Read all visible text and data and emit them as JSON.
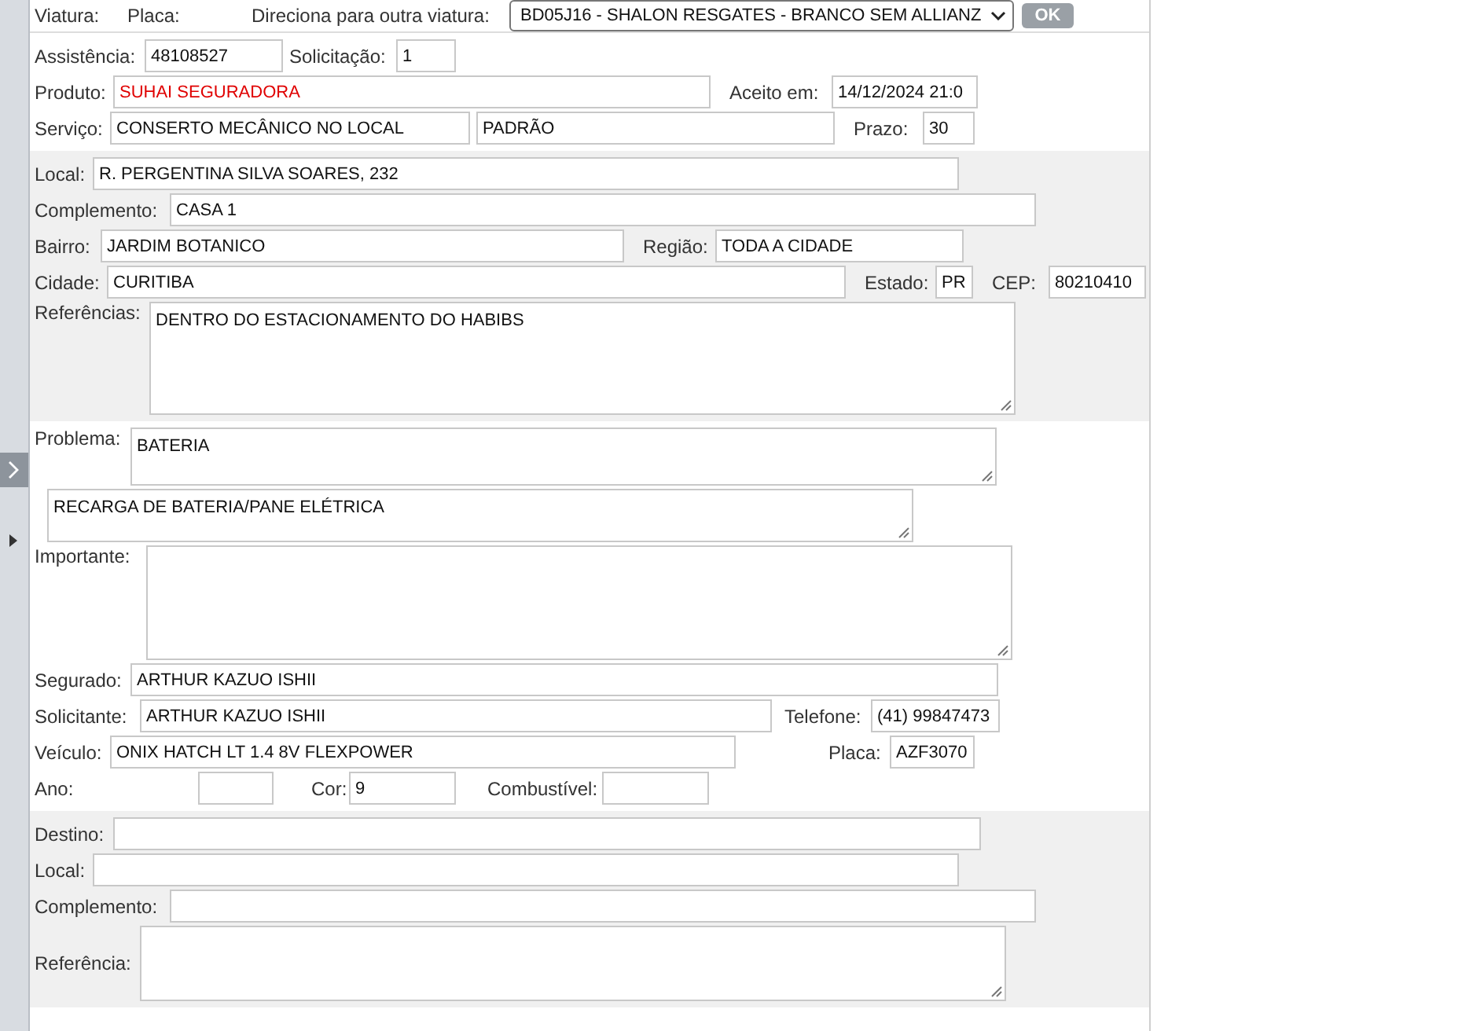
{
  "top_bar": {
    "viatura_label": "Viatura:",
    "placa_label": "Placa:",
    "redirect_label": "Direciona para outra viatura:",
    "vehicle_select": "BD05J16 - SHALON RESGATES - BRANCO SEM ALLIANZ",
    "ok_button": "OK"
  },
  "sections": [
    {
      "shaded": false,
      "rows": [
        {
          "fields": [
            {
              "label": "Assistência:",
              "value": "48108527",
              "kind": "input"
            },
            {
              "label": "Solicitação:",
              "value": "1",
              "kind": "input"
            }
          ]
        },
        {
          "fields": [
            {
              "label": "Produto:",
              "value": "SUHAI SEGURADORA",
              "kind": "input",
              "color": "#e00000"
            },
            {
              "label": "Aceito em:",
              "value": "14/12/2024 21:0",
              "kind": "input"
            }
          ]
        },
        {
          "fields": [
            {
              "label": "Serviço:",
              "value": "CONSERTO MECÂNICO NO LOCAL",
              "kind": "input"
            },
            {
              "value": "PADRÃO",
              "kind": "input"
            },
            {
              "label": "Prazo:",
              "value": "30",
              "kind": "input"
            }
          ]
        }
      ]
    },
    {
      "shaded": true,
      "rows": [
        {
          "fields": [
            {
              "label": "Local:",
              "value": "R. PERGENTINA SILVA SOARES, 232",
              "kind": "input"
            }
          ]
        },
        {
          "fields": [
            {
              "label": "Complemento:",
              "value": "CASA 1",
              "kind": "input"
            }
          ]
        },
        {
          "fields": [
            {
              "label": "Bairro:",
              "value": "JARDIM BOTANICO",
              "kind": "input"
            },
            {
              "label": "Região:",
              "value": "TODA A CIDADE",
              "kind": "input"
            }
          ]
        },
        {
          "fields": [
            {
              "label": "Cidade:",
              "value": "CURITIBA",
              "kind": "input"
            },
            {
              "label": "Estado:",
              "value": "PR",
              "kind": "input"
            },
            {
              "label": "CEP:",
              "value": "80210410",
              "kind": "input"
            }
          ]
        },
        {
          "fields": [
            {
              "label": "Referências:",
              "value": "DENTRO DO ESTACIONAMENTO DO HABIBS",
              "kind": "textarea"
            }
          ]
        }
      ]
    },
    {
      "shaded": false,
      "rows": [
        {
          "fields": [
            {
              "label": "Problema:",
              "value": "BATERIA",
              "kind": "textarea"
            }
          ]
        },
        {
          "fields": [
            {
              "value": "RECARGA DE BATERIA/PANE ELÉTRICA",
              "kind": "textarea"
            }
          ]
        },
        {
          "fields": [
            {
              "label": "Importante:",
              "kind": "textarea"
            }
          ]
        },
        {
          "fields": [
            {
              "label": "Segurado:",
              "value": "ARTHUR KAZUO ISHII",
              "kind": "input"
            }
          ]
        },
        {
          "fields": [
            {
              "label": "Solicitante:",
              "value": "ARTHUR KAZUO ISHII",
              "kind": "input"
            },
            {
              "label": "Telefone:",
              "value": "(41) 99847473",
              "kind": "input"
            }
          ]
        },
        {
          "fields": [
            {
              "label": "Veículo:",
              "value": "ONIX HATCH LT 1.4 8V FLEXPOWER",
              "kind": "input"
            },
            {
              "label": "Placa:",
              "value": "AZF3070",
              "kind": "input"
            }
          ]
        },
        {
          "fields": [
            {
              "label": "Ano:",
              "kind": "input"
            },
            {
              "label": "Cor:",
              "value": "9",
              "kind": "input"
            },
            {
              "label": "Combustível:",
              "kind": "input"
            }
          ]
        }
      ]
    },
    {
      "shaded": true,
      "rows": [
        {
          "fields": [
            {
              "label": "Destino:",
              "kind": "input"
            }
          ]
        },
        {
          "fields": [
            {
              "label": "Local:",
              "kind": "input"
            }
          ]
        },
        {
          "fields": [
            {
              "label": "Complemento:",
              "kind": "input"
            }
          ]
        },
        {
          "fields": [
            {
              "label": "Referência:",
              "kind": "textarea"
            }
          ]
        }
      ]
    }
  ]
}
